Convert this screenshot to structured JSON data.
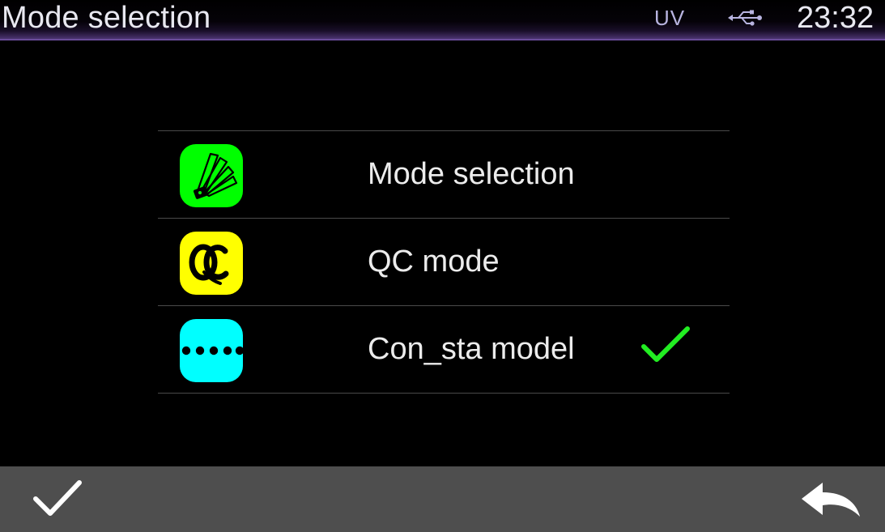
{
  "header": {
    "title": "Mode selection",
    "uv_label": "UV",
    "usb_icon": "usb-icon",
    "time": "23:32"
  },
  "modes": [
    {
      "label": "Mode selection",
      "icon": "fan-deck-icon",
      "color": "#00ff00",
      "selected": false
    },
    {
      "label": "QC mode",
      "icon": "qc-icon",
      "color": "#ffff00",
      "selected": false
    },
    {
      "label": "Con_sta model",
      "icon": "dots-icon",
      "color": "#00ffff",
      "selected": true
    }
  ],
  "colors": {
    "background": "#000000",
    "header_accent": "#6a4c9a",
    "footer": "#4e4e4e",
    "check": "#22ee22"
  },
  "footer": {
    "confirm_icon": "checkmark-icon",
    "back_icon": "back-arrow-icon"
  }
}
